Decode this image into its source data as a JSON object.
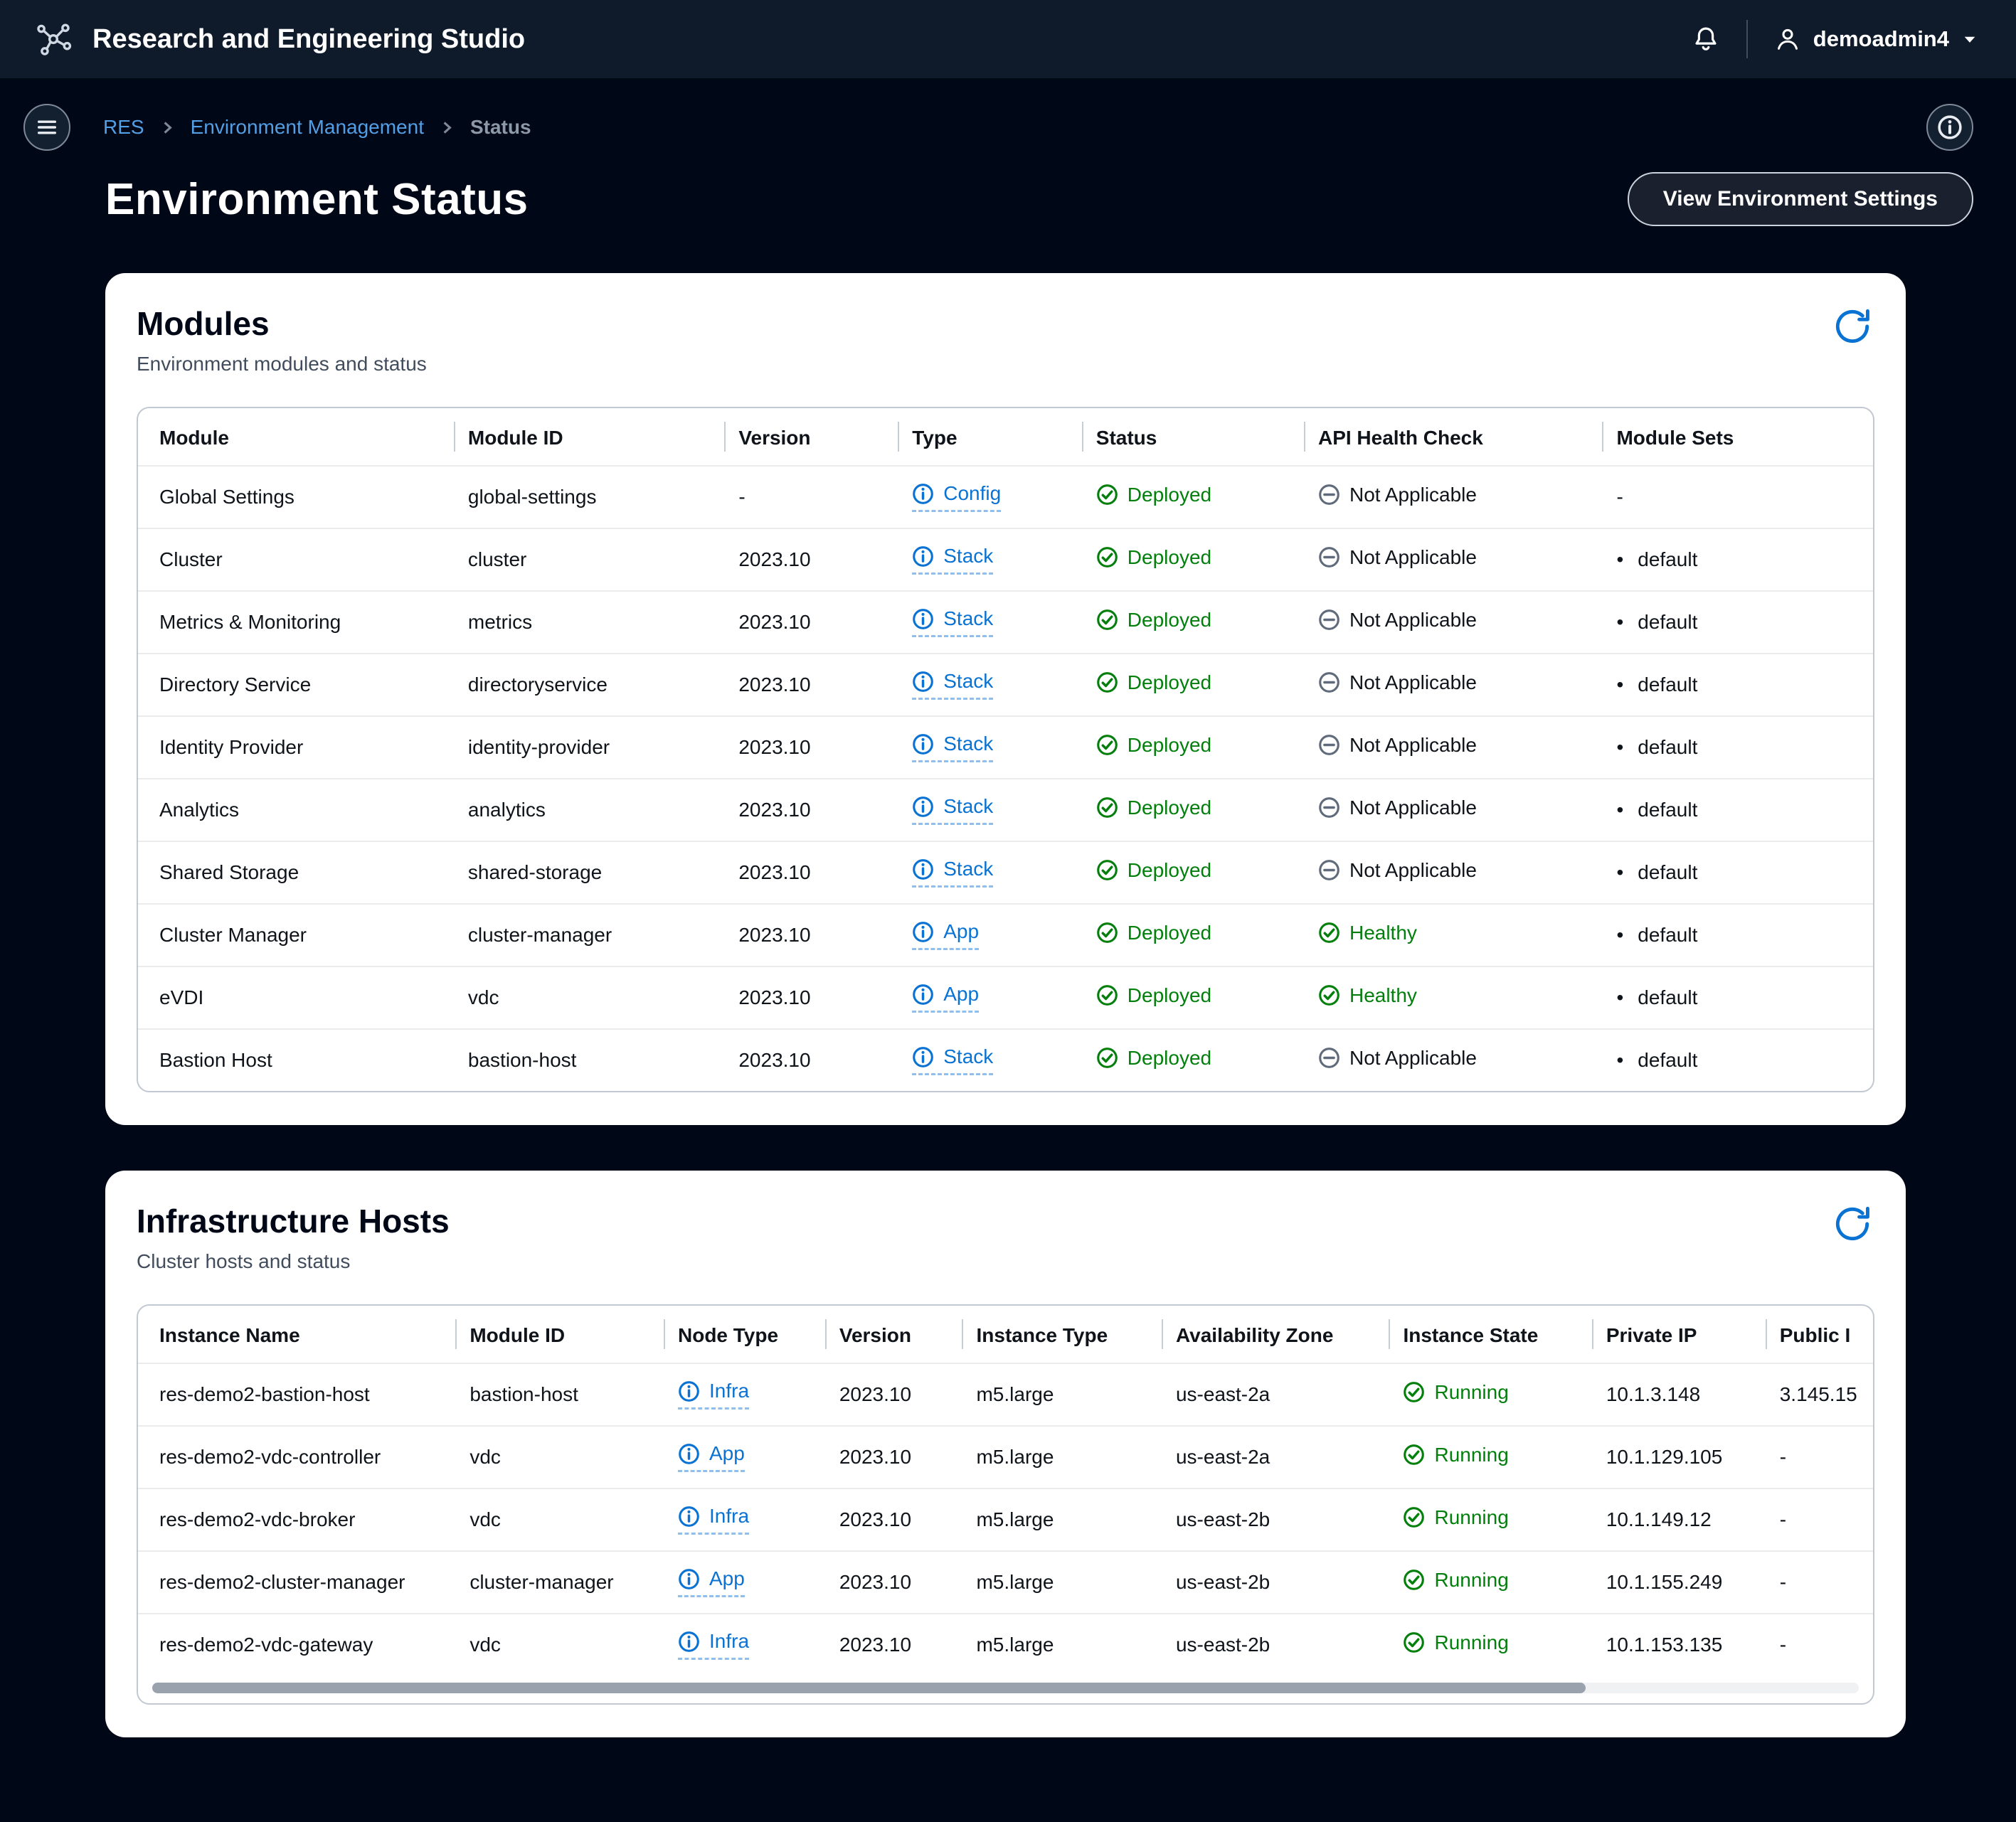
{
  "topbar": {
    "title": "Research and Engineering Studio",
    "user": "demoadmin4"
  },
  "breadcrumb": {
    "items": [
      "RES",
      "Environment Management",
      "Status"
    ]
  },
  "page": {
    "title": "Environment Status",
    "settings_button": "View Environment Settings"
  },
  "modules": {
    "title": "Modules",
    "subtitle": "Environment modules and status",
    "columns": [
      "Module",
      "Module ID",
      "Version",
      "Type",
      "Status",
      "API Health Check",
      "Module Sets"
    ],
    "rows": [
      {
        "module": "Global Settings",
        "id": "global-settings",
        "version": "-",
        "type": "Config",
        "status": "Deployed",
        "health": "Not Applicable",
        "sets": "-"
      },
      {
        "module": "Cluster",
        "id": "cluster",
        "version": "2023.10",
        "type": "Stack",
        "status": "Deployed",
        "health": "Not Applicable",
        "sets": "default"
      },
      {
        "module": "Metrics & Monitoring",
        "id": "metrics",
        "version": "2023.10",
        "type": "Stack",
        "status": "Deployed",
        "health": "Not Applicable",
        "sets": "default"
      },
      {
        "module": "Directory Service",
        "id": "directoryservice",
        "version": "2023.10",
        "type": "Stack",
        "status": "Deployed",
        "health": "Not Applicable",
        "sets": "default"
      },
      {
        "module": "Identity Provider",
        "id": "identity-provider",
        "version": "2023.10",
        "type": "Stack",
        "status": "Deployed",
        "health": "Not Applicable",
        "sets": "default"
      },
      {
        "module": "Analytics",
        "id": "analytics",
        "version": "2023.10",
        "type": "Stack",
        "status": "Deployed",
        "health": "Not Applicable",
        "sets": "default"
      },
      {
        "module": "Shared Storage",
        "id": "shared-storage",
        "version": "2023.10",
        "type": "Stack",
        "status": "Deployed",
        "health": "Not Applicable",
        "sets": "default"
      },
      {
        "module": "Cluster Manager",
        "id": "cluster-manager",
        "version": "2023.10",
        "type": "App",
        "status": "Deployed",
        "health": "Healthy",
        "sets": "default"
      },
      {
        "module": "eVDI",
        "id": "vdc",
        "version": "2023.10",
        "type": "App",
        "status": "Deployed",
        "health": "Healthy",
        "sets": "default"
      },
      {
        "module": "Bastion Host",
        "id": "bastion-host",
        "version": "2023.10",
        "type": "Stack",
        "status": "Deployed",
        "health": "Not Applicable",
        "sets": "default"
      }
    ]
  },
  "hosts": {
    "title": "Infrastructure Hosts",
    "subtitle": "Cluster hosts and status",
    "columns": [
      "Instance Name",
      "Module ID",
      "Node Type",
      "Version",
      "Instance Type",
      "Availability Zone",
      "Instance State",
      "Private IP",
      "Public I"
    ],
    "rows": [
      {
        "name": "res-demo2-bastion-host",
        "module_id": "bastion-host",
        "node_type": "Infra",
        "version": "2023.10",
        "instance_type": "m5.large",
        "az": "us-east-2a",
        "state": "Running",
        "private_ip": "10.1.3.148",
        "public_ip": "3.145.15"
      },
      {
        "name": "res-demo2-vdc-controller",
        "module_id": "vdc",
        "node_type": "App",
        "version": "2023.10",
        "instance_type": "m5.large",
        "az": "us-east-2a",
        "state": "Running",
        "private_ip": "10.1.129.105",
        "public_ip": "-"
      },
      {
        "name": "res-demo2-vdc-broker",
        "module_id": "vdc",
        "node_type": "Infra",
        "version": "2023.10",
        "instance_type": "m5.large",
        "az": "us-east-2b",
        "state": "Running",
        "private_ip": "10.1.149.12",
        "public_ip": "-"
      },
      {
        "name": "res-demo2-cluster-manager",
        "module_id": "cluster-manager",
        "node_type": "App",
        "version": "2023.10",
        "instance_type": "m5.large",
        "az": "us-east-2b",
        "state": "Running",
        "private_ip": "10.1.155.249",
        "public_ip": "-"
      },
      {
        "name": "res-demo2-vdc-gateway",
        "module_id": "vdc",
        "node_type": "Infra",
        "version": "2023.10",
        "instance_type": "m5.large",
        "az": "us-east-2b",
        "state": "Running",
        "private_ip": "10.1.153.135",
        "public_ip": "-"
      }
    ]
  },
  "colors": {
    "accent": "#0972d3",
    "success": "#037f0c",
    "link_on_dark": "#539fe5"
  }
}
